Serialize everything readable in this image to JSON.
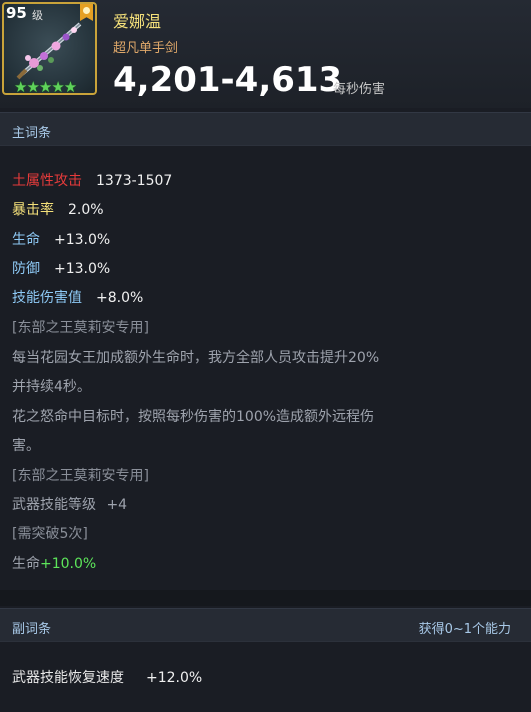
{
  "item": {
    "level": "95",
    "level_unit": "级",
    "name": "爱娜温",
    "type": "超凡单手剑",
    "dps": "4,201-4,613",
    "dps_label": "每秒伤害",
    "stars": "★★★★★"
  },
  "main_section": {
    "title": "主词条"
  },
  "stats": [
    {
      "label": "土属性攻击",
      "value": "1373-1507"
    },
    {
      "label": "暴击率",
      "value": "2.0%"
    },
    {
      "label": "生命",
      "value": "+13.0%"
    },
    {
      "label": "防御",
      "value": "+13.0%"
    },
    {
      "label": "技能伤害值",
      "value": "+8.0%"
    }
  ],
  "effects": {
    "exclusive_1": "[东部之王莫莉安专用]",
    "desc_1a": "每当花园女王加成额外生命时，我方全部人员攻击提升20%",
    "desc_1b": "并持续4秒。",
    "desc_2a": "花之怒命中目标时，按照每秒伤害的100%造成额外远程伤",
    "desc_2b": "害。",
    "exclusive_2": "[东部之王莫莉安专用]",
    "skill_level_label": "武器技能等级",
    "skill_level_value": "+4",
    "breakthrough": "[需突破5次]",
    "hp_label": "生命",
    "hp_value": "+10.0%"
  },
  "sub_section": {
    "title": "副词条",
    "note": "获得0~1个能力"
  },
  "sub_stats": [
    {
      "label": "武器技能恢复速度",
      "value": "+12.0%"
    }
  ],
  "colors": {
    "background": "#1a1d24",
    "gold_border": "#c9a33a",
    "fire_label": "#e63b3b",
    "crit_label": "#f4e07a",
    "stat_label": "#8ec9f5",
    "green_value": "#5de55a"
  }
}
